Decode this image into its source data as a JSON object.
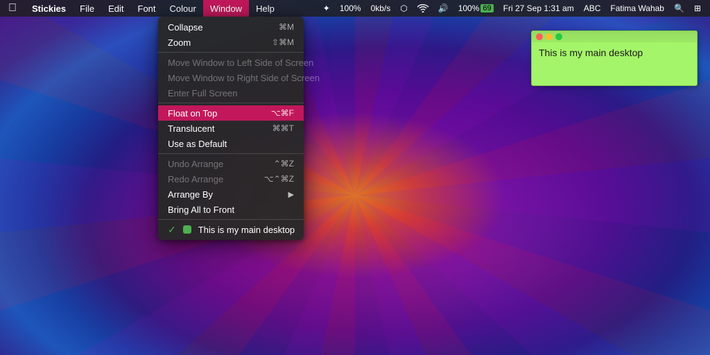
{
  "menubar": {
    "apple": "⌘",
    "app_name": "Stickies",
    "menus": [
      "File",
      "Edit",
      "Font",
      "Colour",
      "Window",
      "Help"
    ],
    "active_menu": "Window",
    "right": {
      "brightness": "✦",
      "brightness_pct": "100%",
      "network": "0kb/s",
      "bluetooth": "⬡",
      "wifi": "WiFi",
      "battery_pct": "100%",
      "battery_label": "69",
      "date_time": "Fri 27 Sep  1:31 am",
      "keyboard": "ABC",
      "user": "Fatima Wahab",
      "search": "🔍",
      "controls": "⊞"
    }
  },
  "dropdown": {
    "items": [
      {
        "id": "collapse",
        "label": "Collapse",
        "shortcut": "⌘M",
        "disabled": false,
        "highlighted": false
      },
      {
        "id": "zoom",
        "label": "Zoom",
        "shortcut": "⇧⌘M",
        "disabled": false,
        "highlighted": false
      },
      {
        "id": "separator1",
        "type": "separator"
      },
      {
        "id": "move-left",
        "label": "Move Window to Left Side of Screen",
        "shortcut": "",
        "disabled": true,
        "highlighted": false
      },
      {
        "id": "move-right",
        "label": "Move Window to Right Side of Screen",
        "shortcut": "",
        "disabled": true,
        "highlighted": false
      },
      {
        "id": "fullscreen",
        "label": "Enter Full Screen",
        "shortcut": "",
        "disabled": true,
        "highlighted": false
      },
      {
        "id": "separator2",
        "type": "separator"
      },
      {
        "id": "float-on-top",
        "label": "Float on Top",
        "shortcut": "⌥⌘F",
        "disabled": false,
        "highlighted": true
      },
      {
        "id": "translucent",
        "label": "Translucent",
        "shortcut": "⌘⌘T",
        "disabled": false,
        "highlighted": false
      },
      {
        "id": "use-as-default",
        "label": "Use as Default",
        "shortcut": "",
        "disabled": false,
        "highlighted": false
      },
      {
        "id": "separator3",
        "type": "separator"
      },
      {
        "id": "undo-arrange",
        "label": "Undo Arrange",
        "shortcut": "⌃⌘Z",
        "disabled": true,
        "highlighted": false
      },
      {
        "id": "redo-arrange",
        "label": "Redo Arrange",
        "shortcut": "⌥⌃⌘Z",
        "disabled": true,
        "highlighted": false
      },
      {
        "id": "arrange-by",
        "label": "Arrange By",
        "shortcut": "",
        "disabled": false,
        "highlighted": false,
        "arrow": true
      },
      {
        "id": "bring-all-front",
        "label": "Bring All to Front",
        "shortcut": "",
        "disabled": false,
        "highlighted": false
      },
      {
        "id": "separator4",
        "type": "separator"
      },
      {
        "id": "main-desktop",
        "label": "This is my main desktop",
        "shortcut": "",
        "disabled": false,
        "highlighted": false,
        "checked": true,
        "dot": true
      }
    ]
  },
  "sticky": {
    "text": "This is my main desktop",
    "bg_color": "#a5f56a"
  }
}
